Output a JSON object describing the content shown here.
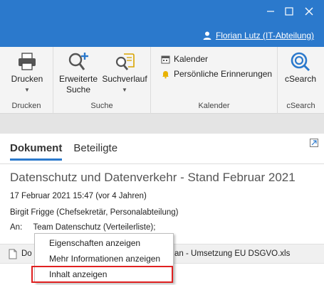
{
  "window": {
    "user_name": "Florian Lutz (IT-Abteilung)",
    "colors": {
      "titlebar": "#2b79cc",
      "highlight": "#e02020"
    }
  },
  "ribbon": {
    "groups": {
      "drucken": {
        "label": "Drucken",
        "button_label": "Drucken"
      },
      "suche": {
        "label": "Suche",
        "erweiterte_line1": "Erweiterte",
        "erweiterte_line2": "Suche",
        "suchverlauf_label": "Suchverlauf"
      },
      "kalender": {
        "label": "Kalender",
        "kalender_label": "Kalender",
        "erinnerungen_label": "Persönliche Erinnerungen"
      },
      "csearch": {
        "label": "cSearch",
        "button_label": "cSearch"
      }
    }
  },
  "document": {
    "tabs": [
      "Dokument",
      "Beteiligte"
    ],
    "subject": "Datenschutz und Datenverkehr - Stand Februar 2021",
    "date": "17 Februar 2021 15:47 (vor 4 Jahren)",
    "sender": "Birgit Frigge (Chefsekretär, Personalabteilung)",
    "to_label": "An:",
    "to_value": "Team Datenschutz (Verteilerliste);",
    "attachment_prefix": "Do",
    "attachment_suffix": "an - Umsetzung EU DSGVO.xls"
  },
  "context_menu": {
    "items": [
      "Eigenschaften anzeigen",
      "Mehr Informationen anzeigen",
      "Inhalt anzeigen"
    ],
    "highlighted": "Inhalt anzeigen"
  }
}
